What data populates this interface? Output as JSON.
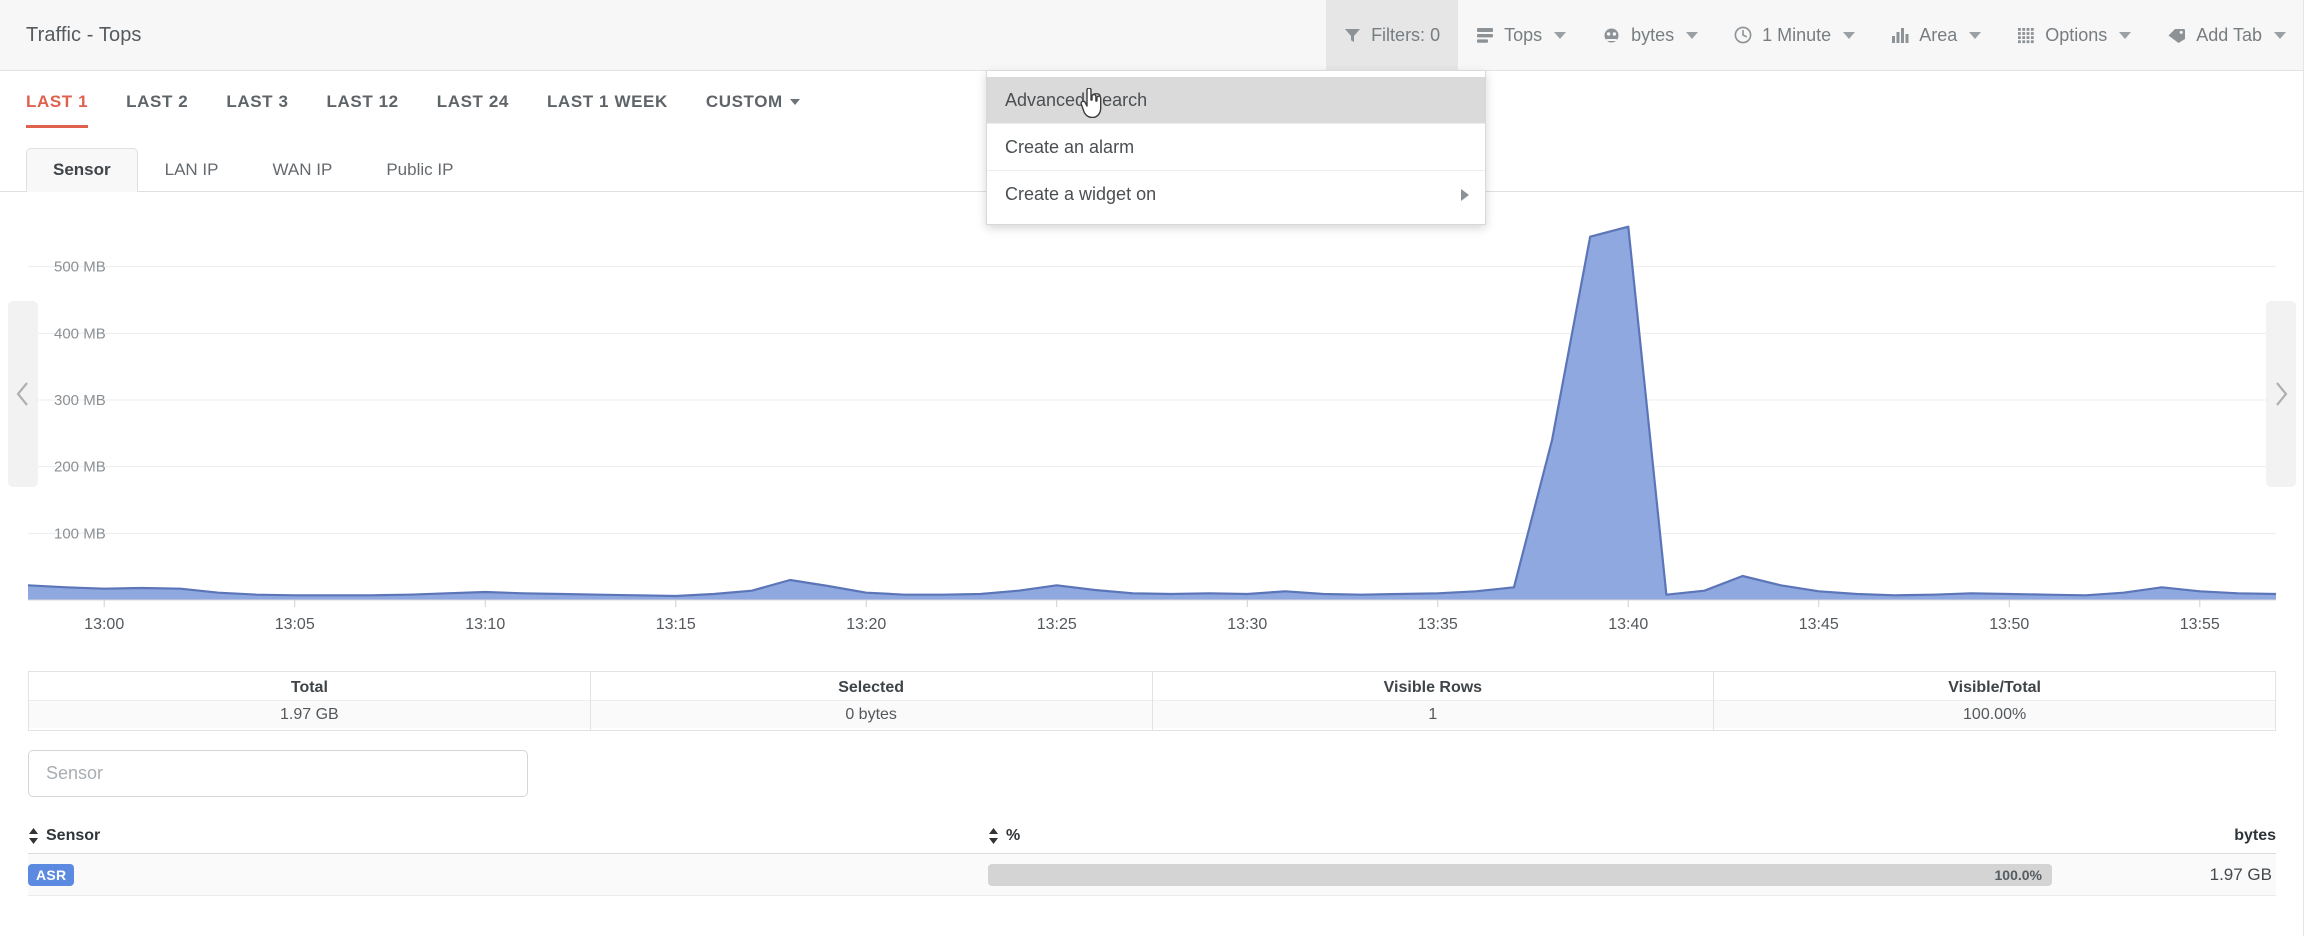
{
  "header": {
    "title": "Traffic - Tops",
    "toolbar": [
      {
        "label": "Filters: 0",
        "icon": "funnel-icon",
        "caret": false,
        "active": true,
        "name": "filters-button"
      },
      {
        "label": "Tops",
        "icon": "list-icon",
        "caret": true,
        "active": false,
        "name": "tops-dropdown"
      },
      {
        "label": "bytes",
        "icon": "scale-icon",
        "caret": true,
        "active": false,
        "name": "bytes-dropdown"
      },
      {
        "label": "1 Minute",
        "icon": "clock-icon",
        "caret": true,
        "active": false,
        "name": "interval-dropdown"
      },
      {
        "label": "Area",
        "icon": "bar-chart-icon",
        "caret": true,
        "active": false,
        "name": "charttype-dropdown"
      },
      {
        "label": "Options",
        "icon": "grid-icon",
        "caret": true,
        "active": false,
        "name": "options-dropdown"
      },
      {
        "label": "Add Tab",
        "icon": "tag-icon",
        "caret": true,
        "active": false,
        "name": "add-tab-dropdown"
      }
    ]
  },
  "time_ranges": {
    "items": [
      {
        "label": "LAST 1",
        "selected": true,
        "caret": false
      },
      {
        "label": "LAST 2",
        "selected": false,
        "caret": false
      },
      {
        "label": "LAST 3",
        "selected": false,
        "caret": false
      },
      {
        "label": "LAST 12",
        "selected": false,
        "caret": false
      },
      {
        "label": "LAST 24",
        "selected": false,
        "caret": false
      },
      {
        "label": "LAST 1 WEEK",
        "selected": false,
        "caret": false
      },
      {
        "label": "CUSTOM",
        "selected": false,
        "caret": true
      }
    ]
  },
  "subtabs": {
    "items": [
      {
        "label": "Sensor",
        "active": true
      },
      {
        "label": "LAN IP",
        "active": false
      },
      {
        "label": "WAN IP",
        "active": false
      },
      {
        "label": "Public IP",
        "active": false
      }
    ]
  },
  "menu": {
    "items": [
      {
        "label": "Advanced Search",
        "highlighted": true,
        "submenu": false
      },
      {
        "label": "Create an alarm",
        "highlighted": false,
        "submenu": false
      },
      {
        "label": "Create a widget on",
        "highlighted": false,
        "submenu": true
      }
    ]
  },
  "stats": {
    "columns": [
      {
        "header": "Total",
        "value": "1.97 GB"
      },
      {
        "header": "Selected",
        "value": "0 bytes"
      },
      {
        "header": "Visible Rows",
        "value": "1"
      },
      {
        "header": "Visible/Total",
        "value": "100.00%"
      }
    ]
  },
  "filter": {
    "placeholder": "Sensor",
    "value": ""
  },
  "table": {
    "headers": {
      "sensor": "Sensor",
      "percent": "%",
      "bytes": "bytes"
    },
    "rows": [
      {
        "sensor": "ASR",
        "percent_label": "100.0%",
        "percent_value": 100.0,
        "bytes": "1.97 GB"
      }
    ]
  },
  "nav": {
    "left": "prev-period",
    "right": "next-period"
  },
  "colors": {
    "accent_red": "#e0614e",
    "area_fill": "#8fa8e0",
    "area_stroke": "#5b75b8",
    "badge_blue": "#5b8ae0",
    "toolbar_text": "#777d81"
  },
  "chart_data": {
    "type": "area",
    "title": "",
    "xlabel": "",
    "ylabel": "",
    "ylim": [
      0,
      600
    ],
    "ytick_labels": [
      "100 MB",
      "200 MB",
      "300 MB",
      "400 MB",
      "500 MB"
    ],
    "ytick_values": [
      100,
      200,
      300,
      400,
      500
    ],
    "grid": true,
    "legend": false,
    "x_tick_labels": [
      "13:00",
      "13:05",
      "13:10",
      "13:15",
      "13:20",
      "13:25",
      "13:30",
      "13:35",
      "13:40",
      "13:45",
      "13:50",
      "13:55"
    ],
    "unit": "MB",
    "series": [
      {
        "name": "ASR",
        "x": [
          "12:58",
          "12:59",
          "13:00",
          "13:01",
          "13:02",
          "13:03",
          "13:04",
          "13:05",
          "13:06",
          "13:07",
          "13:08",
          "13:09",
          "13:10",
          "13:11",
          "13:12",
          "13:13",
          "13:14",
          "13:15",
          "13:16",
          "13:17",
          "13:18",
          "13:19",
          "13:20",
          "13:21",
          "13:22",
          "13:23",
          "13:24",
          "13:25",
          "13:26",
          "13:27",
          "13:28",
          "13:29",
          "13:30",
          "13:31",
          "13:32",
          "13:33",
          "13:34",
          "13:35",
          "13:36",
          "13:37",
          "13:38",
          "13:39",
          "13:40",
          "13:41",
          "13:42",
          "13:43",
          "13:44",
          "13:45",
          "13:46",
          "13:47",
          "13:48",
          "13:49",
          "13:50",
          "13:51",
          "13:52",
          "13:53",
          "13:54",
          "13:55",
          "13:56",
          "13:57"
        ],
        "values": [
          22,
          19,
          17,
          18,
          17,
          11,
          8,
          7,
          7,
          7,
          8,
          10,
          12,
          10,
          9,
          8,
          7,
          6,
          9,
          14,
          30,
          21,
          11,
          8,
          8,
          9,
          14,
          22,
          15,
          10,
          9,
          10,
          9,
          13,
          9,
          8,
          9,
          10,
          13,
          19,
          240,
          545,
          560,
          8,
          14,
          36,
          22,
          13,
          9,
          7,
          8,
          10,
          9,
          8,
          7,
          11,
          19,
          13,
          10,
          9
        ]
      }
    ]
  }
}
